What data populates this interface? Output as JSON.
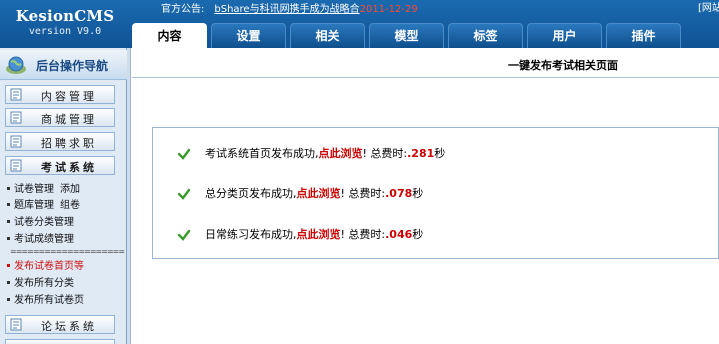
{
  "header": {
    "logo_name": "KesionCMS",
    "logo_version": "version V9.0",
    "notice_label": "官方公告:",
    "notice_link": "bShare与科讯网携手成为战略合",
    "notice_date": "2011-12-29",
    "corner_text": "[网站"
  },
  "tabs": [
    {
      "label": "内容",
      "active": true
    },
    {
      "label": "设置"
    },
    {
      "label": "相关"
    },
    {
      "label": "模型"
    },
    {
      "label": "标签"
    },
    {
      "label": "用户"
    },
    {
      "label": "插件"
    }
  ],
  "sidebar": {
    "nav_title": "后台操作导航",
    "menus": [
      {
        "label": "内容管理",
        "icon": "doc-icon"
      },
      {
        "label": "商城管理",
        "icon": "shop-icon"
      },
      {
        "label": "招聘求职",
        "icon": "job-icon"
      },
      {
        "label": "考试系统",
        "icon": "exam-icon",
        "open": true
      },
      {
        "label": "论坛系统",
        "icon": "forum-icon"
      }
    ],
    "exam_items": [
      {
        "a": "试卷管理",
        "b": "添加"
      },
      {
        "a": "题库管理",
        "b": "组卷"
      },
      {
        "a": "试卷分类管理"
      },
      {
        "a": "考试成绩管理"
      },
      {
        "a": "发布试卷首页等",
        "highlight": true
      },
      {
        "a": "发布所有分类"
      },
      {
        "a": "发布所有试卷页"
      }
    ],
    "separator": "===================="
  },
  "main": {
    "page_title": "一键发布考试相关页面",
    "results": [
      {
        "text": "考试系统首页发布成功,",
        "link": "点此浏览",
        "after": "! 总费时:",
        "time": ".281",
        "unit": "秒"
      },
      {
        "text": "总分类页发布成功,",
        "link": "点此浏览",
        "after": "! 总费时:",
        "time": ".078",
        "unit": "秒"
      },
      {
        "text": "日常练习发布成功,",
        "link": "点此浏览",
        "after": "! 总费时:",
        "time": ".046",
        "unit": "秒"
      }
    ]
  }
}
